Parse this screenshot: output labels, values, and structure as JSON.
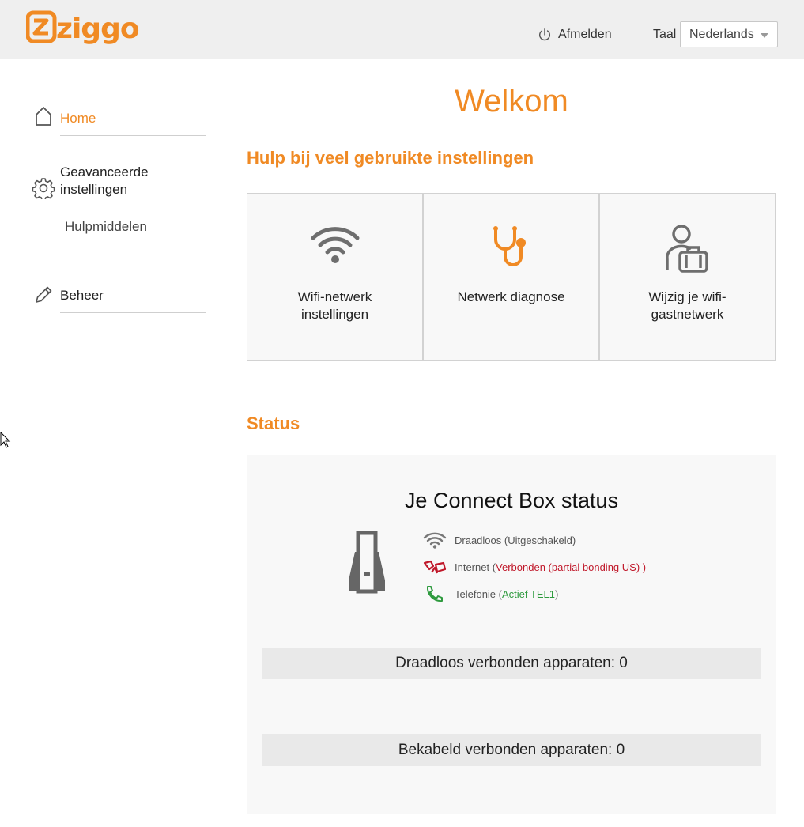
{
  "header": {
    "logo_text": "ziggo",
    "logout_label": "Afmelden",
    "language_label": "Taal",
    "language_selected": "Nederlands"
  },
  "sidebar": {
    "items": [
      {
        "label": "Home",
        "icon": "home-icon",
        "active": true
      },
      {
        "label": "Geavanceerde",
        "label2": "instellingen",
        "icon": "gear-icon"
      },
      {
        "label": "Hulpmiddelen"
      },
      {
        "label": "Beheer",
        "icon": "pencil-icon"
      }
    ]
  },
  "main": {
    "title": "Welkom",
    "quick_title": "Hulp bij veel gebruikte instellingen",
    "cards": [
      {
        "line1": "Wifi-netwerk",
        "line2": "instellingen",
        "icon": "wifi-icon"
      },
      {
        "line1": "Netwerk diagnose",
        "line2": "",
        "icon": "stethoscope-icon"
      },
      {
        "line1": "Wijzig je wifi-",
        "line2": "gastnetwerk",
        "icon": "guest-user-icon"
      }
    ],
    "status_title": "Status",
    "status": {
      "box_title": "Je Connect Box status",
      "wireless_label": "Draadloos (",
      "wireless_value": "Uitgeschakeld",
      "wireless_end": ")",
      "internet_label": "Internet (",
      "internet_value": "Verbonden (partial bonding US) )",
      "phone_label": "Telefonie (",
      "phone_value": "Actief TEL1",
      "phone_end": ")",
      "wireless_devices": "Draadloos verbonden apparaten: 0",
      "wired_devices": "Bekabeld verbonden apparaten: 0"
    }
  },
  "colors": {
    "brand": "#f08a24",
    "error": "#c0182a",
    "ok": "#2e9a3e"
  }
}
